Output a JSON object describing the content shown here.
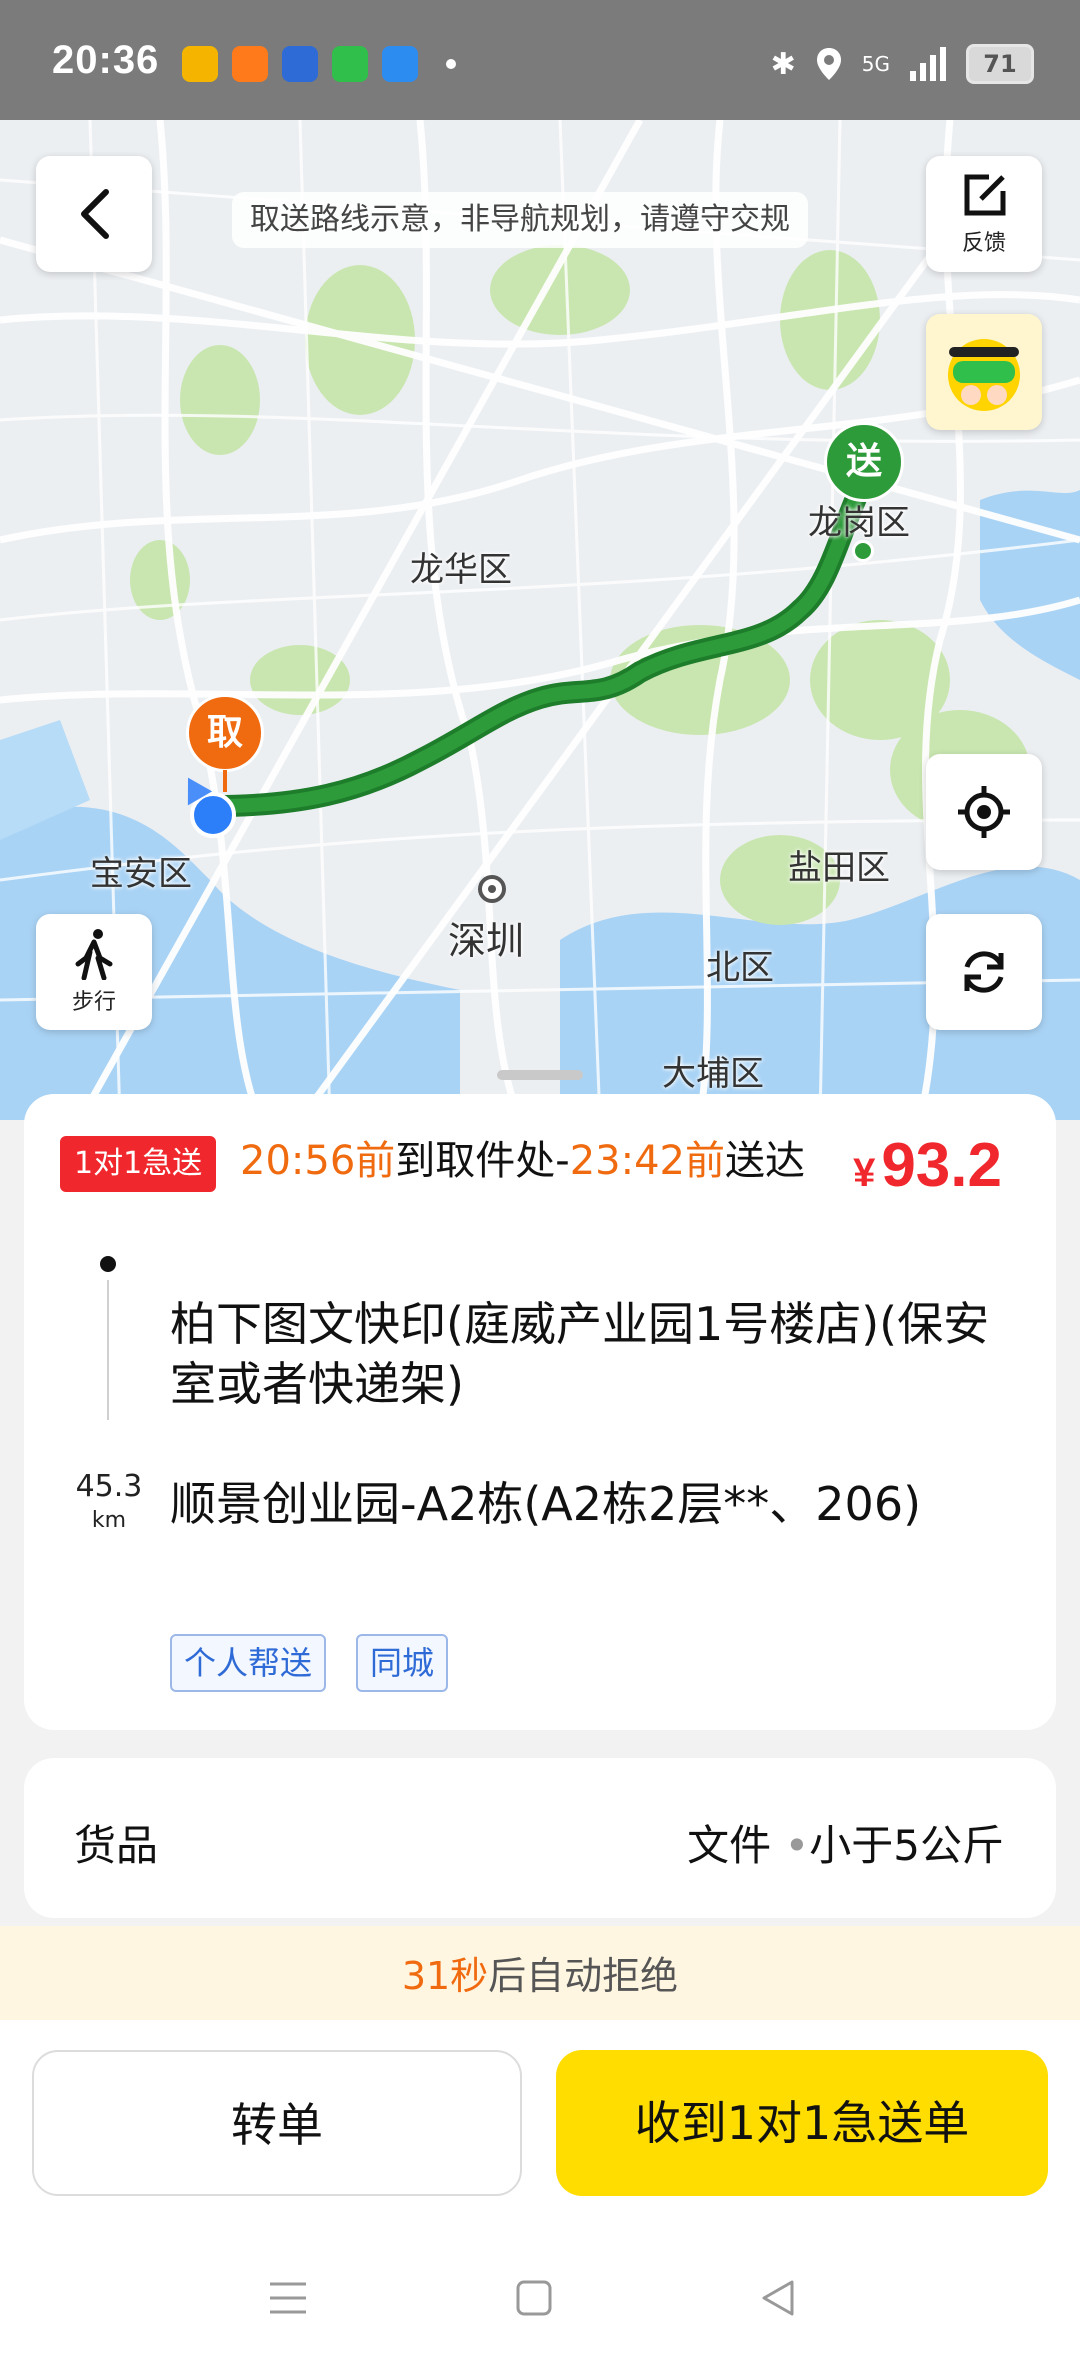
{
  "status_bar": {
    "time": "20:36",
    "battery": "71",
    "signal_label": "5G",
    "app_icons": [
      {
        "name": "folder-app-icon",
        "color": "#f5b400"
      },
      {
        "name": "home-app-icon",
        "color": "#ff7a1a"
      },
      {
        "name": "baidu-app-icon",
        "color": "#2f6bd6"
      },
      {
        "name": "message-app-icon",
        "color": "#2fbf4a"
      },
      {
        "name": "browser-app-icon",
        "color": "#2d8cf0"
      }
    ]
  },
  "map": {
    "notice": "取送路线示意，非导航规划，请遵守交规",
    "feedback_label": "反馈",
    "walk_label": "步行",
    "pickup_marker": "取",
    "delivery_marker": "送",
    "labels": {
      "longhua": "龙华区",
      "longgang": "龙岗区",
      "baoan": "宝安区",
      "shenzhen": "深圳",
      "yantian": "盐田区",
      "north": "北区",
      "dapeng": "大埔区"
    },
    "route_color": "#2e9b3a",
    "pickup_color": "#f06a0f"
  },
  "order": {
    "tag": "1对1急送",
    "pickup_time": "20:56前",
    "pickup_text": "到取件处-",
    "deliver_time": "23:42前",
    "deliver_text": "送达",
    "price_symbol": "¥",
    "price": "93.2",
    "pickup_address": "柏下图文快印(庭威产业园1号楼店)(保安室或者快递架)",
    "delivery_address": "顺景创业园-A2栋(A2栋2层**、206)",
    "distance": "45.3",
    "distance_unit": "km",
    "tags": [
      "个人帮送",
      "同城"
    ]
  },
  "goods": {
    "title": "货品",
    "type": "文件",
    "separator": "•",
    "weight": "小于5公斤"
  },
  "auto_reject": {
    "seconds": "31秒",
    "text": "后自动拒绝"
  },
  "actions": {
    "transfer": "转单",
    "accept": "收到1对1急送单"
  }
}
